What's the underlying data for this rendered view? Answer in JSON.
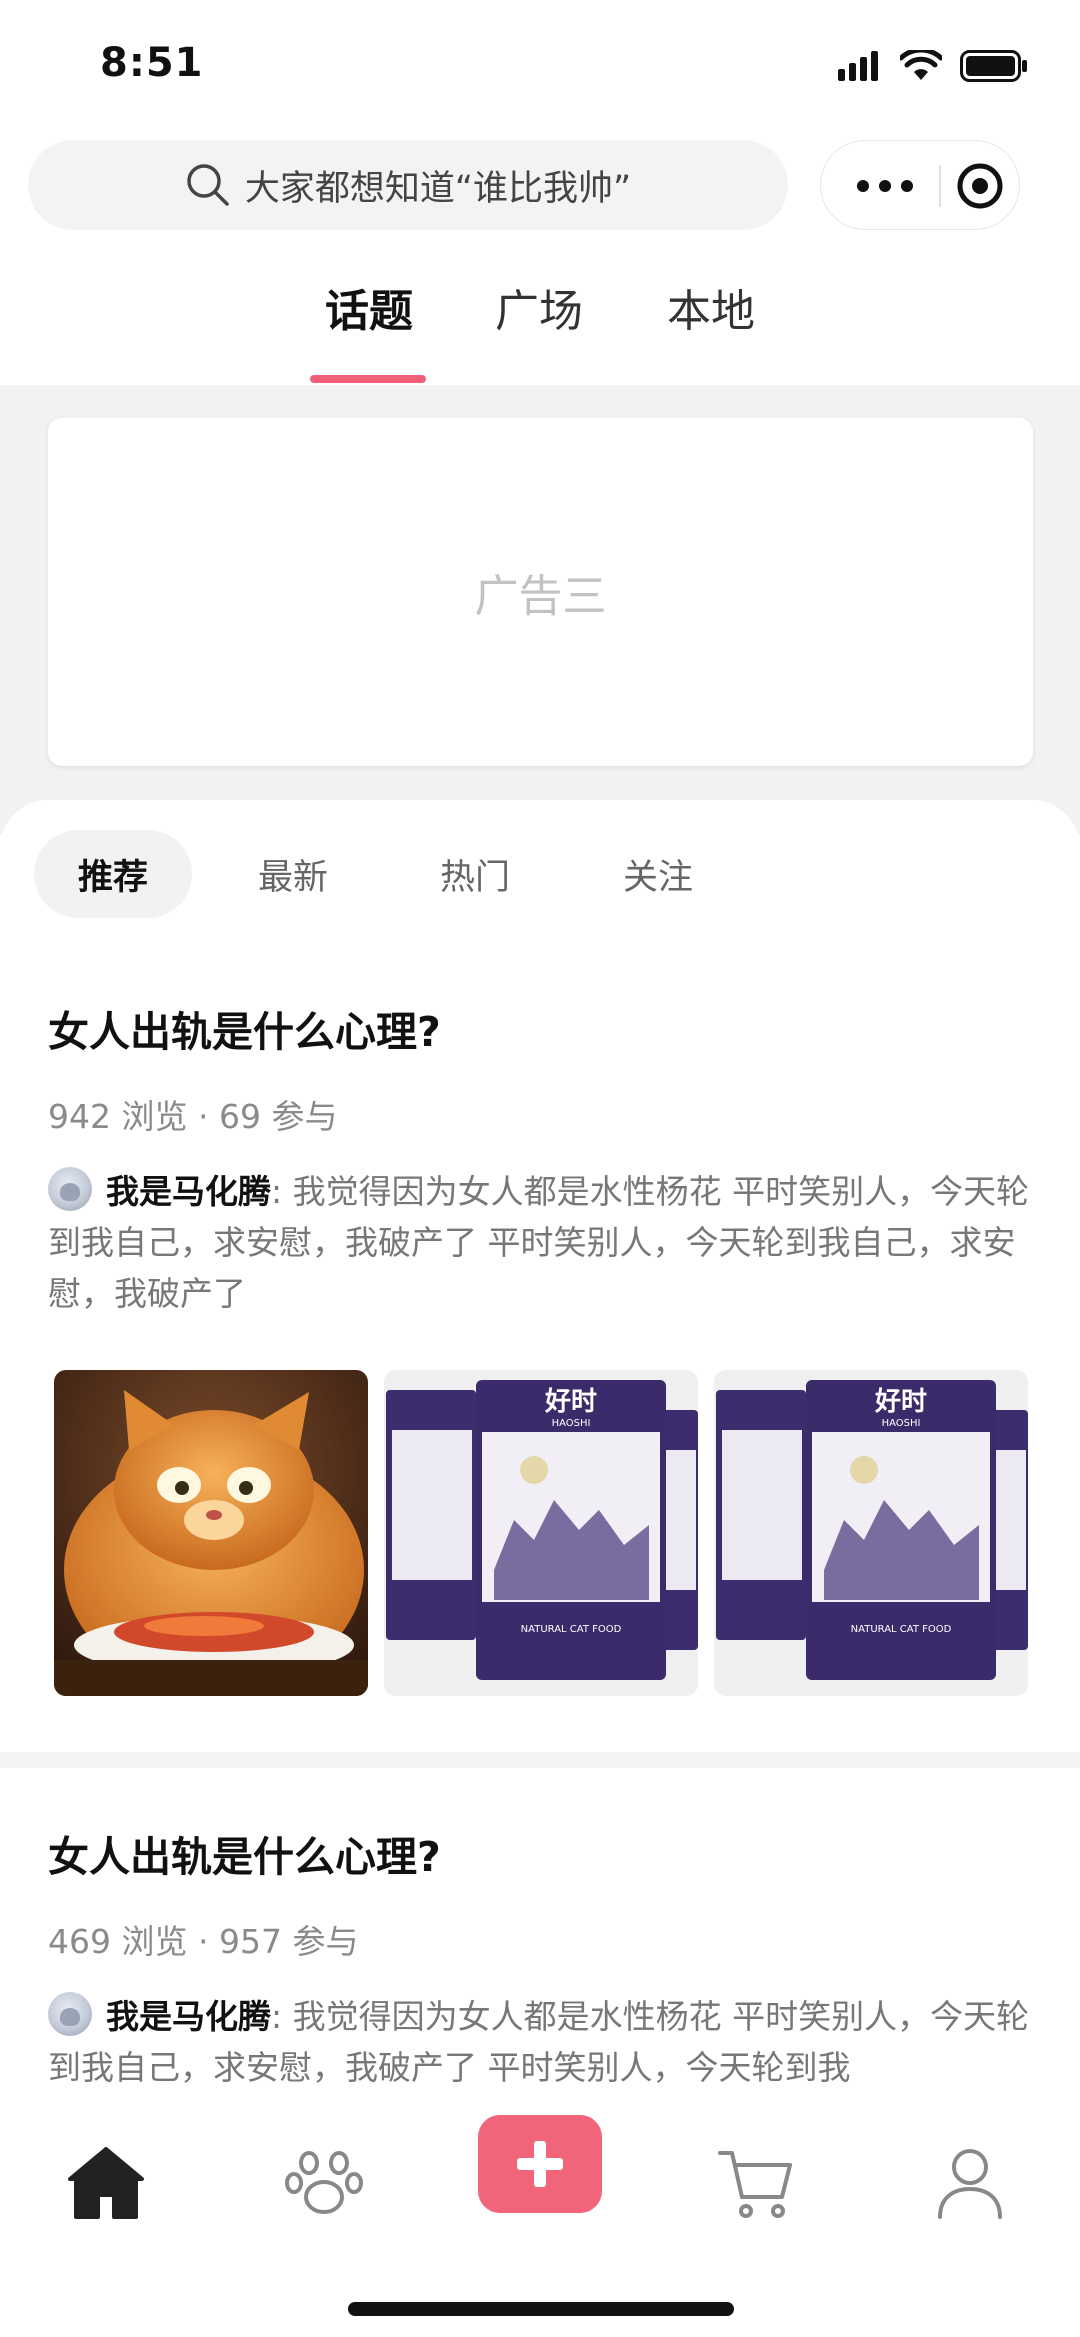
{
  "status_bar": {
    "time": "8:51",
    "icons": [
      "signal-icon",
      "wifi-icon",
      "battery-icon"
    ]
  },
  "search": {
    "placeholder": "大家都想知道“谁比我帅”",
    "icon": "search-icon"
  },
  "capsule": {
    "more_icon": "more-dots-icon",
    "close_icon": "miniprogram-target-icon"
  },
  "top_tabs": [
    {
      "label": "话题",
      "active": true
    },
    {
      "label": "广场",
      "active": false
    },
    {
      "label": "本地",
      "active": false
    }
  ],
  "ad": {
    "label": "广告三"
  },
  "sub_tabs": [
    {
      "label": "推荐",
      "active": true
    },
    {
      "label": "最新",
      "active": false
    },
    {
      "label": "热门",
      "active": false
    },
    {
      "label": "关注",
      "active": false
    }
  ],
  "posts": [
    {
      "title": "女人出轨是什么心理?",
      "views": "942 浏览",
      "separator": " · ",
      "participants": "69 参与",
      "author": "我是马化腾",
      "text": ": 我觉得因为女人都是水性杨花 平时笑别人，今天轮到我自己，求安慰，我破产了 平时笑别人，今天轮到我自己，求安慰，我破产了",
      "images": [
        "orange-cat-eating-photo",
        "haoshi-cat-food-bag-photo",
        "haoshi-cat-food-bag-photo"
      ],
      "bag_brand_cn": "好时",
      "bag_brand_en": "HAOSHI",
      "bag_caption": "NATURAL CAT FOOD"
    },
    {
      "title": "女人出轨是什么心理?",
      "views": "469 浏览",
      "separator": " · ",
      "participants": "957 参与",
      "author": "我是马化腾",
      "text": ": 我觉得因为女人都是水性杨花 平时笑别人，今天轮到我自己，求安慰，我破产了 平时笑别人，今天轮到我"
    }
  ],
  "tab_bar": {
    "items": [
      {
        "icon": "home-icon",
        "active": true
      },
      {
        "icon": "paw-icon",
        "active": false
      },
      {
        "icon": "plus-icon",
        "active": false
      },
      {
        "icon": "cart-icon",
        "active": false
      },
      {
        "icon": "user-icon",
        "active": false
      }
    ],
    "accent": "#f1647a"
  },
  "colors": {
    "accent": "#f0607a",
    "background": "#ffffff",
    "muted_text": "#8a8a8a"
  }
}
